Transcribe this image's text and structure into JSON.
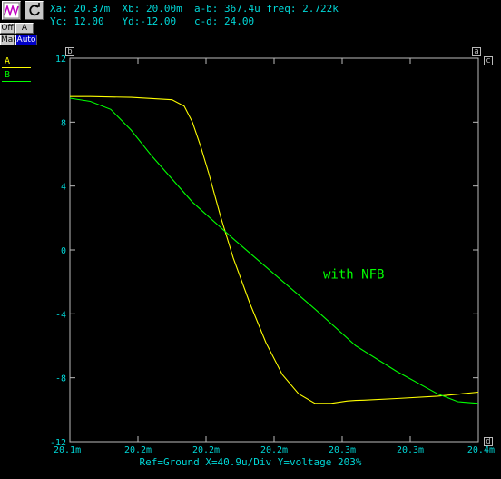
{
  "toolbar": {
    "buttons": [
      {
        "name": "waveform-icon"
      },
      {
        "name": "refresh-icon"
      }
    ],
    "mode_buttons": [
      {
        "label": "Off",
        "bg": "#c8c8c8",
        "fg": "#000"
      },
      {
        "label": "A",
        "bg": "#c8c8c8",
        "fg": "#000"
      },
      {
        "label": "Man",
        "bg": "#c8c8c8",
        "fg": "#000"
      },
      {
        "label": "Auto",
        "bg": "#0000c8",
        "fg": "#fff"
      }
    ]
  },
  "readouts": {
    "row1": "Xa: 20.37m  Xb: 20.00m  a-b: 367.4u freq: 2.722k",
    "row2": "Yc: 12.00   Yd:-12.00   c-d: 24.00"
  },
  "legend": [
    {
      "label": "A",
      "color": "#ffff00"
    },
    {
      "label": "B",
      "color": "#00ff00"
    }
  ],
  "cursor_tags": {
    "a": "a",
    "b": "b",
    "c": "c",
    "d": "d"
  },
  "chart_data": {
    "type": "line",
    "x_tick_labels": [
      "20.1m",
      "20.2m",
      "20.2m",
      "20.2m",
      "20.3m",
      "20.3m",
      "20.4m"
    ],
    "y_tick_labels": [
      "12",
      "8",
      "4",
      "0",
      "-4",
      "-8",
      "-12"
    ],
    "ylim": [
      -12,
      12
    ],
    "xlim": [
      0,
      1
    ],
    "grid": false,
    "annotations": [
      {
        "text": "with NFB",
        "x": 0.62,
        "y": -1.8,
        "color": "#00ff00"
      }
    ],
    "series": [
      {
        "name": "A",
        "color": "#ffff00",
        "x": [
          0,
          0.05,
          0.15,
          0.25,
          0.28,
          0.3,
          0.32,
          0.34,
          0.37,
          0.4,
          0.44,
          0.48,
          0.52,
          0.56,
          0.6,
          0.64,
          0.68,
          0.7,
          0.72,
          0.8,
          0.9,
          1.0
        ],
        "y": [
          9.6,
          9.6,
          9.55,
          9.4,
          9.0,
          8.0,
          6.5,
          4.8,
          2.0,
          -0.5,
          -3.3,
          -5.8,
          -7.8,
          -9.0,
          -9.6,
          -9.6,
          -9.45,
          -9.42,
          -9.4,
          -9.3,
          -9.15,
          -8.9
        ]
      },
      {
        "name": "B",
        "color": "#00ff00",
        "x": [
          0,
          0.05,
          0.1,
          0.15,
          0.2,
          0.3,
          0.4,
          0.5,
          0.6,
          0.7,
          0.8,
          0.9,
          0.95,
          1.0
        ],
        "y": [
          9.5,
          9.3,
          8.8,
          7.5,
          5.9,
          3.0,
          0.7,
          -1.5,
          -3.7,
          -6.0,
          -7.6,
          -9.0,
          -9.5,
          -9.6
        ]
      }
    ]
  },
  "footer": {
    "text": "Ref=Ground  X=40.9u/Div Y=voltage 203%"
  }
}
